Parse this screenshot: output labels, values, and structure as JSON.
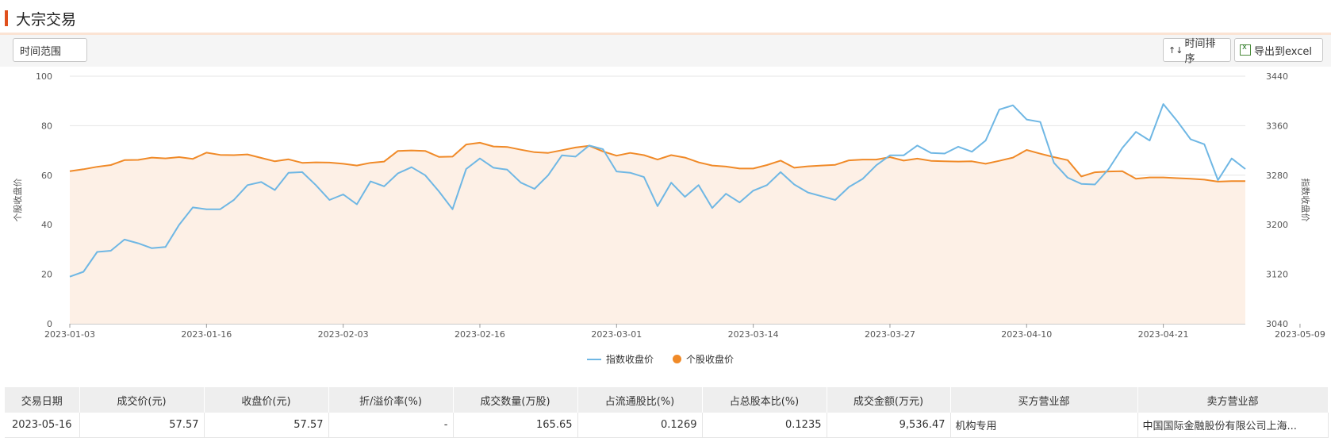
{
  "header": {
    "title": "大宗交易"
  },
  "toolbar": {
    "time_range_label": "时间范围",
    "sort_label": "时间排序",
    "export_label": "导出到excel",
    "sort_icon": "sort-arrows-icon",
    "export_icon": "excel-icon"
  },
  "chart_data": {
    "type": "line",
    "y_left": {
      "label": "个股收盘价",
      "ylim": [
        0,
        100
      ],
      "ticks": [
        0,
        20,
        40,
        60,
        80,
        100
      ]
    },
    "y_right": {
      "label": "指数收盘价",
      "ylim": [
        3040,
        3440
      ],
      "ticks": [
        3040,
        3120,
        3200,
        3280,
        3360,
        3440
      ]
    },
    "x_tick_labels": [
      "2023-01-03",
      "2023-01-16",
      "2023-02-03",
      "2023-02-16",
      "2023-03-01",
      "2023-03-14",
      "2023-03-27",
      "2023-04-10",
      "2023-04-21",
      "2023-05-09"
    ],
    "x_tick_index": [
      0,
      10,
      20,
      30,
      40,
      50,
      60,
      70,
      80,
      90
    ],
    "series": [
      {
        "name": "指数收盘价",
        "axis": "right",
        "color": "#6fb7e4",
        "values": [
          3116,
          3124,
          3156,
          3158,
          3176,
          3170,
          3162,
          3164,
          3200,
          3228,
          3225,
          3225,
          3240,
          3264,
          3269,
          3256,
          3284,
          3285,
          3264,
          3240,
          3249,
          3233,
          3270,
          3262,
          3283,
          3293,
          3280,
          3254,
          3225,
          3290,
          3307,
          3292,
          3289,
          3268,
          3258,
          3280,
          3312,
          3310,
          3328,
          3322,
          3286,
          3284,
          3277,
          3230,
          3268,
          3245,
          3264,
          3227,
          3250,
          3236,
          3255,
          3264,
          3285,
          3265,
          3252,
          3246,
          3240,
          3261,
          3274,
          3296,
          3312,
          3312,
          3328,
          3316,
          3315,
          3326,
          3318,
          3336,
          3386,
          3393,
          3370,
          3366,
          3300,
          3276,
          3266,
          3265,
          3290,
          3324,
          3350,
          3336,
          3395,
          3368,
          3338,
          3330,
          3272,
          3307,
          3290
        ]
      },
      {
        "name": "个股收盘价",
        "axis": "left",
        "color": "#f08a28",
        "values": [
          61.6,
          62.4,
          63.4,
          64.1,
          66.1,
          66.2,
          67.1,
          66.8,
          67.3,
          66.6,
          69.1,
          68.2,
          68.1,
          68.4,
          67.0,
          65.6,
          66.4,
          65.0,
          65.2,
          65.1,
          64.6,
          63.9,
          65.0,
          65.5,
          69.8,
          70.0,
          69.8,
          67.4,
          67.5,
          72.4,
          73.1,
          71.6,
          71.4,
          70.3,
          69.3,
          69.0,
          70.1,
          71.2,
          71.9,
          69.6,
          67.9,
          69.0,
          68.1,
          66.3,
          68.1,
          67.1,
          65.2,
          63.9,
          63.5,
          62.7,
          62.7,
          64.1,
          65.9,
          63.0,
          63.6,
          63.9,
          64.2,
          66.0,
          66.3,
          66.3,
          67.3,
          65.9,
          66.7,
          65.8,
          65.6,
          65.5,
          65.6,
          64.6,
          65.8,
          67.1,
          70.2,
          68.7,
          67.3,
          66.1,
          59.5,
          61.2,
          61.5,
          61.6,
          58.6,
          59.1,
          59.1,
          58.8,
          58.6,
          58.2,
          57.4,
          57.6,
          57.6
        ]
      }
    ],
    "legend": {
      "placement": "bottom-center"
    }
  },
  "table": {
    "headers": [
      "交易日期",
      "成交价(元)",
      "收盘价(元)",
      "折/溢价率(%)",
      "成交数量(万股)",
      "占流通股比(%)",
      "占总股本比(%)",
      "成交金额(万元)",
      "买方营业部",
      "卖方营业部"
    ],
    "rows": [
      [
        "2023-05-16",
        "57.57",
        "57.57",
        "-",
        "165.65",
        "0.1269",
        "0.1235",
        "9,536.47",
        "机构专用",
        "中国国际金融股份有限公司上海..."
      ]
    ]
  }
}
